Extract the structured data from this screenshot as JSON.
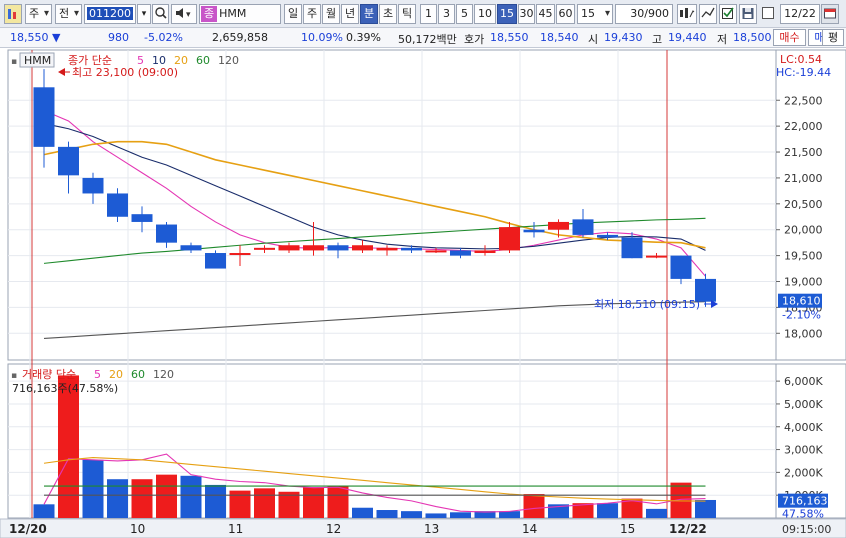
{
  "toolbar": {
    "market": "주",
    "prev_label": "전",
    "code": "011200",
    "tag": "종",
    "name": "HMM",
    "periods": [
      "일",
      "주",
      "월",
      "년",
      "분",
      "초",
      "틱"
    ],
    "active_period": "분",
    "minutes": [
      "1",
      "3",
      "5",
      "10",
      "15",
      "30",
      "45",
      "60"
    ],
    "active_minute": "15",
    "interval": "15",
    "view_count": "30/900",
    "date": "12/22",
    "flat_label": "평"
  },
  "quote": {
    "price": "18,550 ▼",
    "change": "980",
    "change_pct": "-5.02%",
    "volume": "2,659,858",
    "turnover_pct": "10.09%",
    "ratio_pct": "0.39%",
    "amount": "50,172백만",
    "ask_label": "호가",
    "ask1": "18,550",
    "ask2": "18,540",
    "open_label": "시",
    "open": "19,430",
    "high_label": "고",
    "high": "19,440",
    "low_label": "저",
    "low": "18,500",
    "buy_label": "매수",
    "sell_label": "매도"
  },
  "chart": {
    "ticker": "HMM",
    "legend_price": "종가 단순",
    "ma_periods": [
      "5",
      "10",
      "20",
      "60",
      "120"
    ],
    "lc": "LC:0.54",
    "hc": "HC:-19.44",
    "high_note": "최고 23,100 (09:00)",
    "low_note": "최저 18,510 (09:15)",
    "current_price": "18,610",
    "current_change": "-2.10%",
    "vol_legend": "거래량 단순",
    "vol_ma_periods": [
      "5",
      "20",
      "60",
      "120"
    ],
    "vol_note": "716,163주(47.58%)",
    "current_volume": "716,163",
    "current_volume_pct": "47.58%",
    "x_ticks": [
      "12/20",
      "10",
      "11",
      "12",
      "13",
      "14",
      "15",
      "12/22"
    ],
    "time_label": "09:15:00",
    "colors": {
      "up": "#ee1c1c",
      "down": "#1d5bd4",
      "ma5": "#e436b4",
      "ma10": "#1a2d6b",
      "ma20": "#e6a013",
      "ma60": "#1f8a2c",
      "ma120": "#555555"
    }
  },
  "chart_data": [
    {
      "type": "candlestick",
      "y_axis": [
        "22,500",
        "22,000",
        "21,500",
        "21,000",
        "20,500",
        "20,000",
        "19,500",
        "19,000",
        "18,500",
        "18,000"
      ],
      "ylim": [
        17600,
        23200
      ],
      "x": [
        "12/20 09:00",
        "09:15",
        "09:30",
        "09:45",
        "10:00",
        "10:15",
        "10:30",
        "10:45",
        "11:00",
        "11:15",
        "11:30",
        "11:45",
        "12:00",
        "12:15",
        "12:30",
        "12:45",
        "13:00",
        "13:15",
        "13:30",
        "13:45",
        "14:00",
        "14:15",
        "14:30",
        "14:45",
        "15:00",
        "15:15",
        "12/22 09:00",
        "09:15"
      ],
      "open": [
        22750,
        21600,
        21000,
        20700,
        20300,
        20100,
        19700,
        19550,
        19550,
        19650,
        19600,
        19600,
        19700,
        19600,
        19600,
        19650,
        19600,
        19600,
        19550,
        19600,
        20000,
        20000,
        20200,
        19900,
        19850,
        19500,
        19500,
        19050
      ],
      "close": [
        21600,
        21050,
        20700,
        20250,
        20150,
        19750,
        19600,
        19250,
        19550,
        19650,
        19700,
        19700,
        19600,
        19700,
        19650,
        19600,
        19600,
        19500,
        19600,
        20050,
        19950,
        20150,
        19900,
        19850,
        19450,
        19500,
        19050,
        18610
      ],
      "high": [
        23100,
        21700,
        21100,
        20800,
        20450,
        20150,
        19750,
        19600,
        19700,
        19700,
        19750,
        20150,
        19750,
        19800,
        19700,
        19700,
        19650,
        19650,
        19700,
        20150,
        20150,
        20200,
        20400,
        19950,
        19950,
        19550,
        19500,
        19150
      ],
      "low": [
        21200,
        20700,
        20500,
        20150,
        19950,
        19650,
        19550,
        19400,
        19300,
        19550,
        19550,
        19500,
        19450,
        19550,
        19500,
        19550,
        19550,
        19450,
        19500,
        19550,
        19850,
        19850,
        19850,
        19800,
        19450,
        19450,
        18950,
        18510
      ],
      "series": [
        {
          "name": "5",
          "values": [
            22300,
            22100,
            21700,
            21400,
            21100,
            20800,
            20450,
            20150,
            19900,
            19750,
            19660,
            19640,
            19660,
            19650,
            19640,
            19630,
            19620,
            19600,
            19580,
            19620,
            19700,
            19800,
            19900,
            19950,
            19920,
            19820,
            19650,
            19100
          ]
        },
        {
          "name": "10",
          "values": [
            22050,
            21950,
            21800,
            21600,
            21400,
            21250,
            21050,
            20850,
            20650,
            20450,
            20250,
            20050,
            19900,
            19800,
            19720,
            19680,
            19650,
            19640,
            19630,
            19640,
            19680,
            19740,
            19800,
            19850,
            19870,
            19860,
            19820,
            19600
          ]
        },
        {
          "name": "20",
          "values": [
            21450,
            21550,
            21650,
            21700,
            21700,
            21650,
            21500,
            21350,
            21250,
            21150,
            21050,
            20950,
            20850,
            20750,
            20650,
            20550,
            20450,
            20350,
            20250,
            20120,
            20000,
            19900,
            19850,
            19800,
            19780,
            19760,
            19750,
            19650
          ]
        },
        {
          "name": "60",
          "values": [
            19350,
            19400,
            19450,
            19500,
            19550,
            19580,
            19620,
            19660,
            19700,
            19740,
            19770,
            19800,
            19830,
            19860,
            19890,
            19920,
            19950,
            19980,
            20010,
            20040,
            20070,
            20100,
            20130,
            20150,
            20170,
            20190,
            20200,
            20220
          ]
        },
        {
          "name": "120",
          "values": [
            17900,
            17930,
            17960,
            17990,
            18020,
            18050,
            18080,
            18110,
            18140,
            18170,
            18200,
            18230,
            18260,
            18290,
            18320,
            18350,
            18380,
            18410,
            18440,
            18470,
            18500,
            18530,
            18550,
            18570,
            18580,
            18590,
            18600,
            18610
          ]
        }
      ]
    },
    {
      "type": "bar",
      "y_axis": [
        "6,000K",
        "5,000K",
        "4,000K",
        "3,000K",
        "2,000K",
        "1,000K"
      ],
      "ylim": [
        0,
        6400000
      ],
      "x": [
        "12/20 09:00",
        "09:15",
        "09:30",
        "09:45",
        "10:00",
        "10:15",
        "10:30",
        "10:45",
        "11:00",
        "11:15",
        "11:30",
        "11:45",
        "12:00",
        "12:15",
        "12:30",
        "12:45",
        "13:00",
        "13:15",
        "13:30",
        "13:45",
        "14:00",
        "14:15",
        "14:30",
        "14:45",
        "15:00",
        "15:15",
        "12/22 09:00",
        "09:15"
      ],
      "values": [
        600000,
        6250000,
        2550000,
        1700000,
        1700000,
        1900000,
        1850000,
        1450000,
        1200000,
        1300000,
        1150000,
        1350000,
        1400000,
        450000,
        350000,
        300000,
        200000,
        250000,
        300000,
        300000,
        1050000,
        600000,
        650000,
        650000,
        850000,
        400000,
        1550000,
        790000
      ],
      "up": [
        false,
        true,
        false,
        false,
        true,
        true,
        false,
        false,
        true,
        true,
        true,
        true,
        true,
        false,
        false,
        false,
        false,
        false,
        false,
        false,
        true,
        false,
        true,
        false,
        true,
        false,
        true,
        false
      ],
      "series": [
        {
          "name": "5",
          "values": [
            600000,
            2600000,
            2550000,
            2500000,
            2550000,
            2800000,
            1900000,
            1700000,
            1600000,
            1550000,
            1400000,
            1330000,
            1350000,
            1100000,
            900000,
            750000,
            500000,
            300000,
            260000,
            290000,
            420000,
            500000,
            580000,
            650000,
            760000,
            620000,
            820000,
            850000
          ]
        },
        {
          "name": "20",
          "values": [
            2400000,
            2550000,
            2650000,
            2600000,
            2550000,
            2450000,
            2350000,
            2250000,
            2150000,
            2050000,
            1950000,
            1850000,
            1750000,
            1650000,
            1550000,
            1450000,
            1350000,
            1250000,
            1150000,
            1050000,
            980000,
            920000,
            870000,
            830000,
            800000,
            770000,
            750000,
            740000
          ]
        },
        {
          "name": "60",
          "values": [
            1400000,
            1400000,
            1400000,
            1400000,
            1400000,
            1400000,
            1400000,
            1400000,
            1400000,
            1400000,
            1400000,
            1400000,
            1400000,
            1400000,
            1400000,
            1400000,
            1400000,
            1400000,
            1400000,
            1400000,
            1400000,
            1400000,
            1400000,
            1400000,
            1400000,
            1400000,
            1400000,
            1400000
          ]
        },
        {
          "name": "120",
          "values": [
            1000000,
            1000000,
            1000000,
            1000000,
            1000000,
            1000000,
            1000000,
            1000000,
            1000000,
            1000000,
            1000000,
            1000000,
            1000000,
            1000000,
            1000000,
            1000000,
            1000000,
            1000000,
            1000000,
            1000000,
            1000000,
            1000000,
            1000000,
            1000000,
            1000000,
            1000000,
            1000000,
            1000000
          ]
        }
      ]
    }
  ]
}
